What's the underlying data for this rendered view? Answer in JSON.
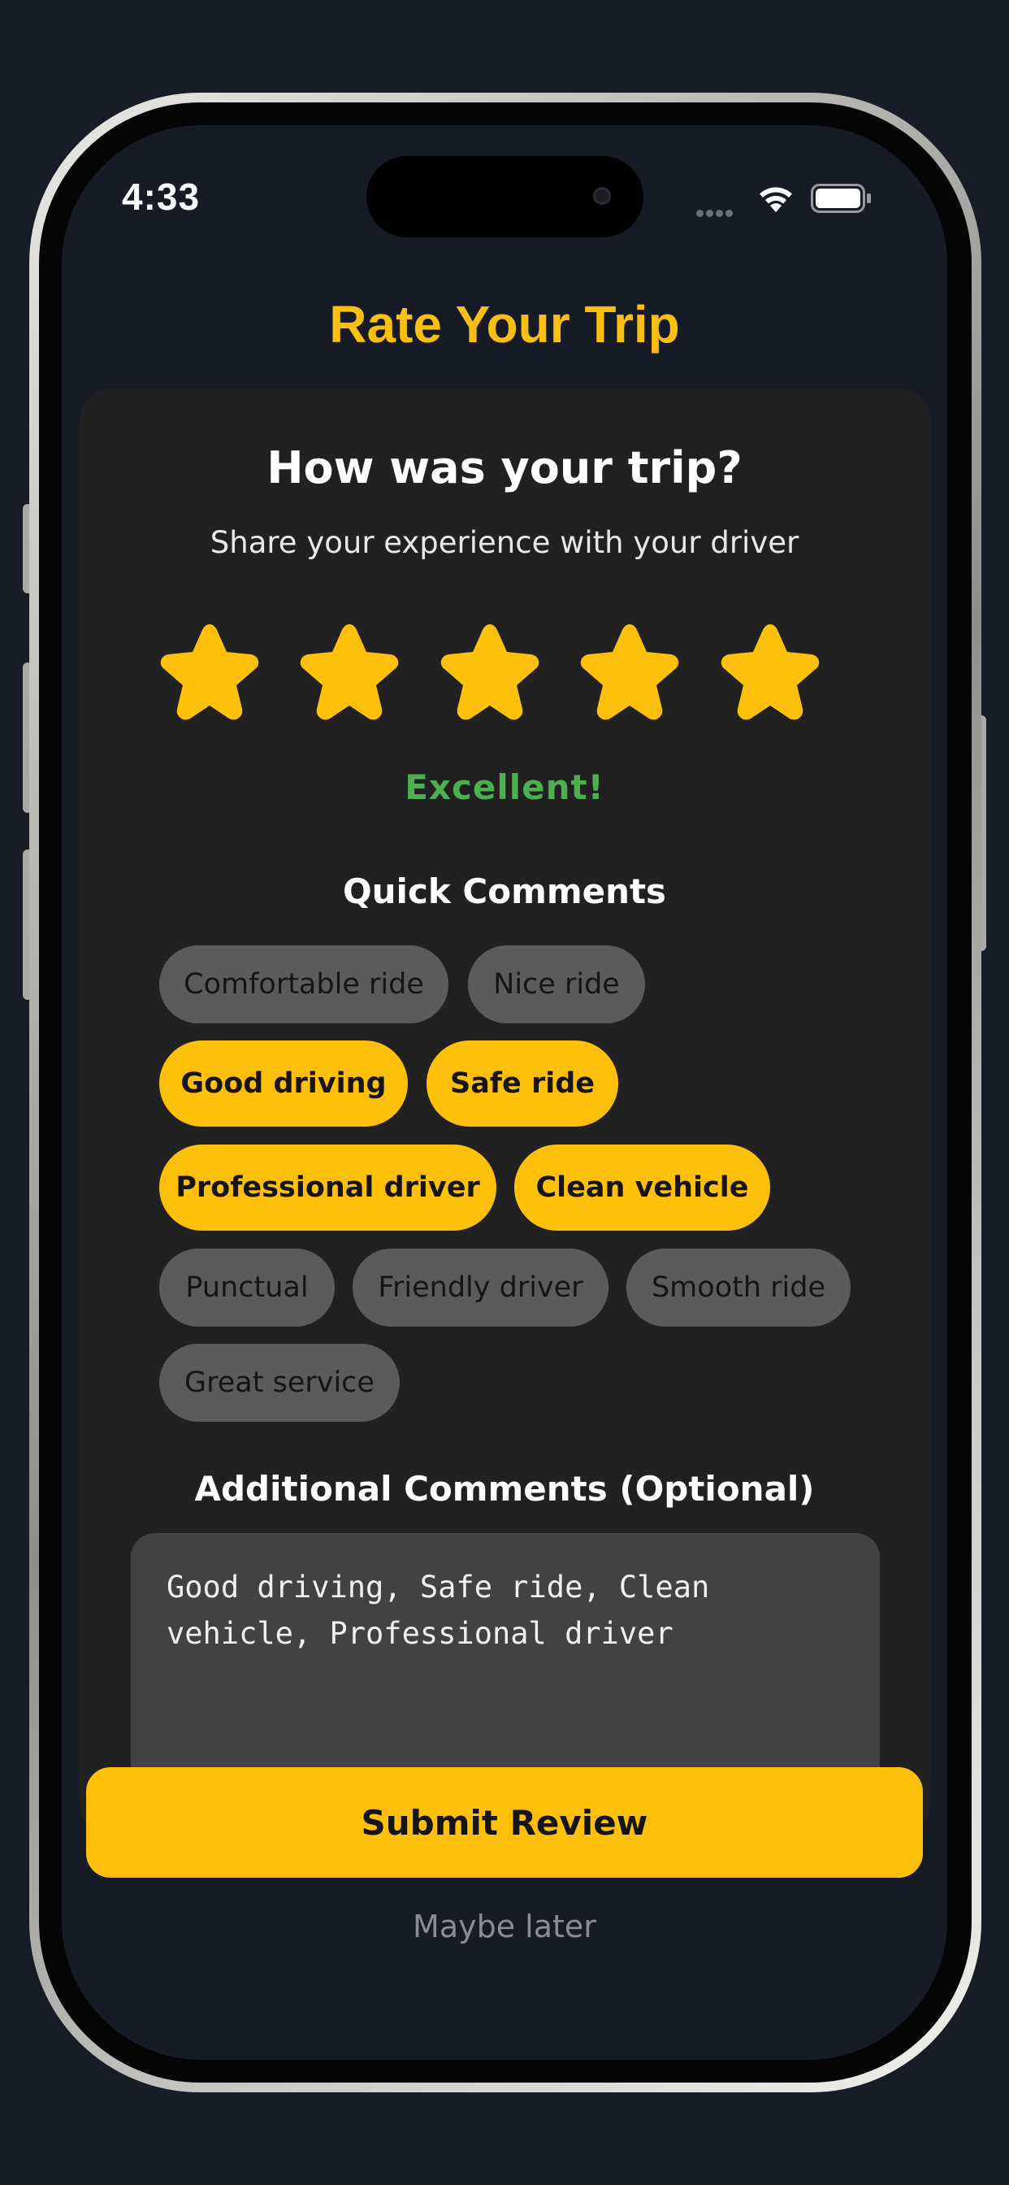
{
  "status_bar": {
    "time": "4:33"
  },
  "header": {
    "title": "Rate Your Trip"
  },
  "card": {
    "title": "How was your trip?",
    "subtitle": "Share your experience with your driver"
  },
  "rating": {
    "value": 5,
    "max": 5,
    "label": "Excellent!",
    "star_color": "#fec00a",
    "label_color": "#4caf50"
  },
  "quick_comments": {
    "title": "Quick Comments",
    "chips": [
      {
        "label": "Comfortable ride",
        "selected": false
      },
      {
        "label": "Nice ride",
        "selected": false
      },
      {
        "label": "Good driving",
        "selected": true
      },
      {
        "label": "Safe ride",
        "selected": true
      },
      {
        "label": "Professional driver",
        "selected": true
      },
      {
        "label": "Clean vehicle",
        "selected": true
      },
      {
        "label": "Punctual",
        "selected": false
      },
      {
        "label": "Friendly driver",
        "selected": false
      },
      {
        "label": "Smooth ride",
        "selected": false
      },
      {
        "label": "Great service",
        "selected": false
      }
    ]
  },
  "additional_comments": {
    "title": "Additional Comments (Optional)",
    "value": "Good driving, Safe ride, Clean vehicle, Professional driver"
  },
  "actions": {
    "submit_label": "Submit Review",
    "later_label": "Maybe later"
  },
  "colors": {
    "accent": "#fec00a",
    "background": "#171b26",
    "card": "#212121",
    "chip_off": "#5b5b5b"
  }
}
